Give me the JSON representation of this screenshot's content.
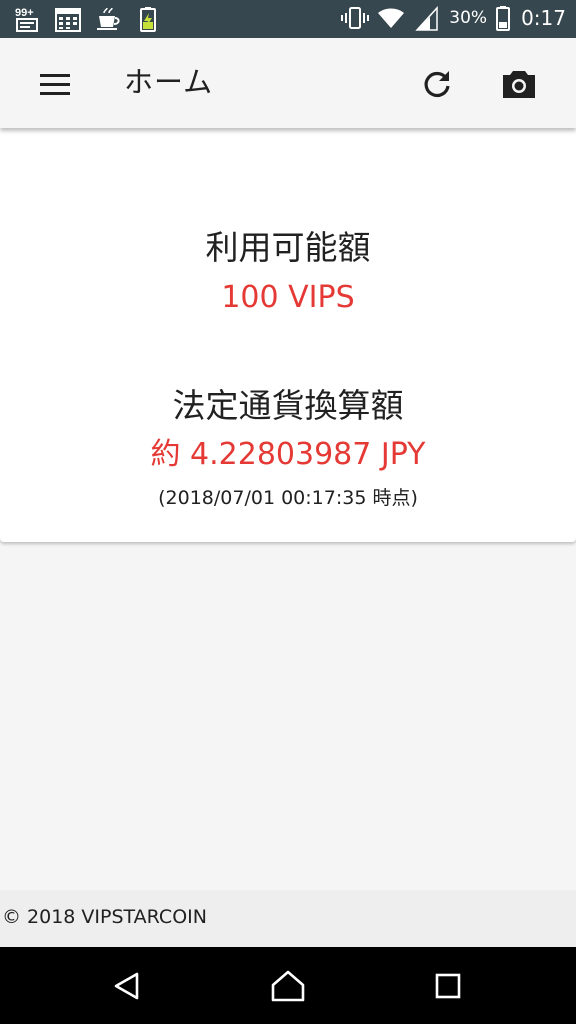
{
  "status_bar": {
    "notification_badge": "99+",
    "battery_percent": "30%",
    "time": "0:17",
    "icons_left": [
      "news-icon",
      "calendar-icon",
      "cup-icon",
      "battery-charging-icon"
    ],
    "icons_right": [
      "vibrate-icon",
      "wifi-icon",
      "signal-icon"
    ]
  },
  "app_bar": {
    "title": "ホーム",
    "icons": [
      "menu-icon",
      "refresh-icon",
      "camera-icon"
    ]
  },
  "balance": {
    "available_label": "利用可能額",
    "available_value": "100 VIPS",
    "fiat_label": "法定通貨換算額",
    "fiat_value": "約 4.22803987 JPY",
    "timestamp": "(2018/07/01 00:17:35 時点)"
  },
  "footer": {
    "copyright": "© 2018 VIPSTARCOIN"
  },
  "nav_bar": {
    "icons": [
      "back-icon",
      "home-icon",
      "recents-icon"
    ]
  },
  "colors": {
    "status_bar": "#37474f",
    "app_bar": "#f5f5f5",
    "accent_red": "#e53935",
    "text": "#212121",
    "nav_bar": "#000000"
  }
}
